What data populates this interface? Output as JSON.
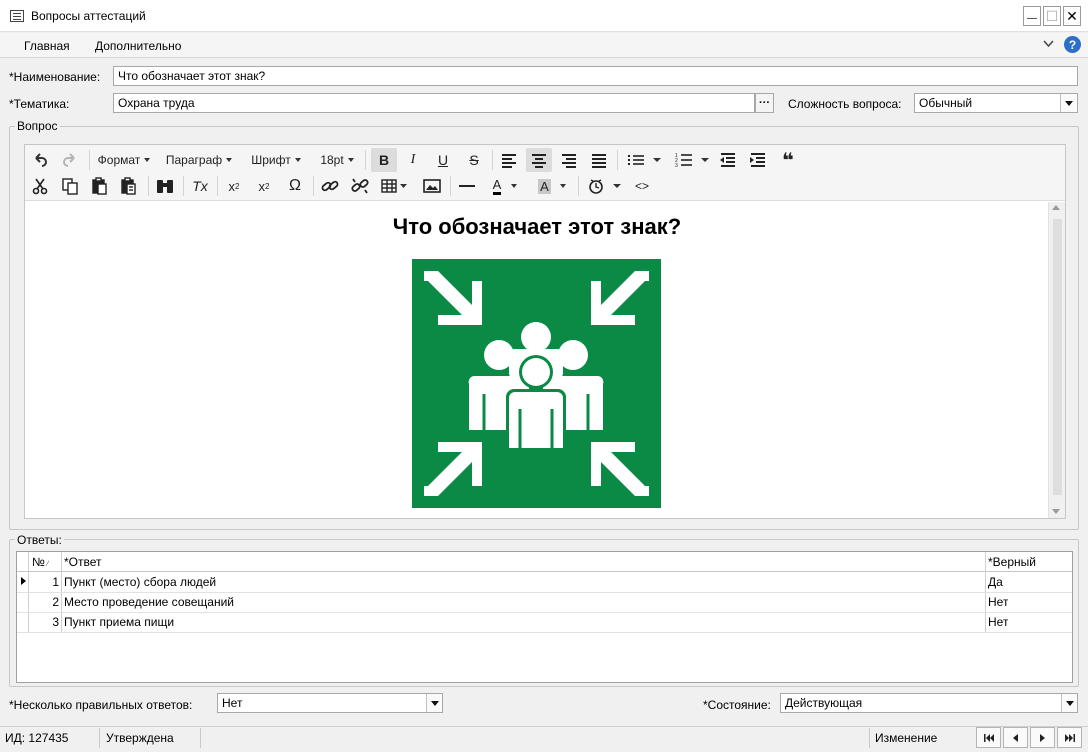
{
  "window": {
    "title": "Вопросы аттестаций",
    "minimize_glyph": "—",
    "maximize_glyph": "☐",
    "close_glyph": "✕"
  },
  "menu": {
    "items": [
      "Главная",
      "Дополнительно"
    ],
    "help_glyph": "?"
  },
  "form": {
    "name_label": "*Наименование:",
    "name_value": "Что обозначает этот знак?",
    "topic_label": "*Тематика:",
    "topic_value": "Охрана труда",
    "topic_button": "···",
    "difficulty_label": "Сложность вопроса:",
    "difficulty_value": "Обычный"
  },
  "question_group": {
    "title": "Вопрос",
    "toolbar": {
      "format": "Формат",
      "paragraph": "Параграф",
      "font": "Шрифт",
      "size": "18pt",
      "bold": "B",
      "italic": "I",
      "underline": "U",
      "strike": "S",
      "quote": "❝",
      "subscript": "x",
      "superscript": "x",
      "omega": "Ω",
      "clear": "Tx",
      "code": "<>",
      "font_color": "A",
      "bg_color": "A"
    },
    "content_heading": "Что обозначает этот знак?",
    "sign_color": "#0a8a45"
  },
  "answers": {
    "title": "Ответы:",
    "columns": {
      "num": "№",
      "answer": "*Ответ",
      "correct": "*Верный"
    },
    "rows": [
      {
        "n": "1",
        "text": "Пункт (место) сбора людей",
        "correct": "Да"
      },
      {
        "n": "2",
        "text": "Место проведение совещаний",
        "correct": "Нет"
      },
      {
        "n": "3",
        "text": "Пункт приема пищи",
        "correct": "Нет"
      }
    ]
  },
  "bottom": {
    "multiple_label": "*Несколько правильных ответов:",
    "multiple_value": "Нет",
    "state_label": "*Состояние:",
    "state_value": "Действующая"
  },
  "status": {
    "id": "ИД: 127435",
    "approved": "Утверждена",
    "mode": "Изменение"
  },
  "colors": {
    "accent": "#2a6fc9",
    "sign_green": "#0a8a45"
  }
}
